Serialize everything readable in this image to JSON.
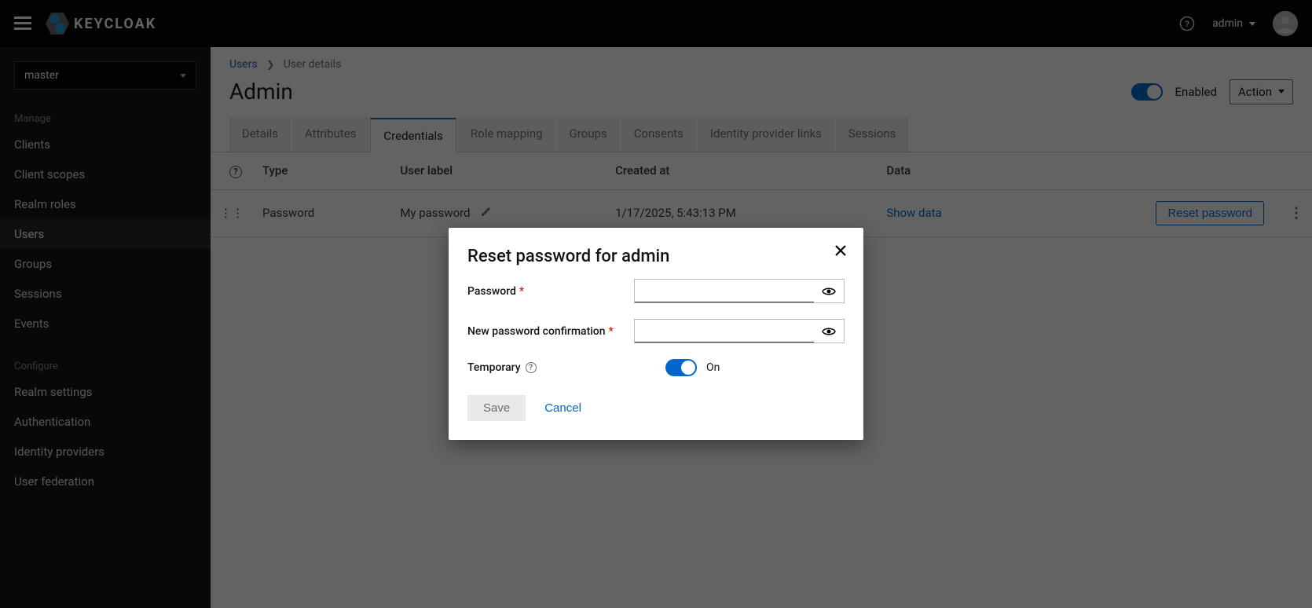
{
  "brand": {
    "name": "KEYCLOAK"
  },
  "header": {
    "username": "admin"
  },
  "sidebar": {
    "realm": "master",
    "section_manage": "Manage",
    "section_configure": "Configure",
    "items": [
      {
        "label": "Clients"
      },
      {
        "label": "Client scopes"
      },
      {
        "label": "Realm roles"
      },
      {
        "label": "Users"
      },
      {
        "label": "Groups"
      },
      {
        "label": "Sessions"
      },
      {
        "label": "Events"
      }
    ],
    "config_items": [
      {
        "label": "Realm settings"
      },
      {
        "label": "Authentication"
      },
      {
        "label": "Identity providers"
      },
      {
        "label": "User federation"
      }
    ]
  },
  "breadcrumb": {
    "root": "Users",
    "current": "User details"
  },
  "page": {
    "title": "Admin",
    "enabled_label": "Enabled",
    "action_label": "Action"
  },
  "tabs": [
    "Details",
    "Attributes",
    "Credentials",
    "Role mapping",
    "Groups",
    "Consents",
    "Identity provider links",
    "Sessions"
  ],
  "credentials": {
    "columns": {
      "type": "Type",
      "user_label": "User label",
      "created_at": "Created at",
      "data": "Data"
    },
    "row": {
      "type": "Password",
      "user_label": "My password",
      "created_at": "1/17/2025, 5:43:13 PM",
      "show_data": "Show data",
      "reset": "Reset password"
    }
  },
  "modal": {
    "title": "Reset password for admin",
    "password_label": "Password",
    "confirm_label": "New password confirmation",
    "temporary_label": "Temporary",
    "temporary_state": "On",
    "save": "Save",
    "cancel": "Cancel"
  }
}
